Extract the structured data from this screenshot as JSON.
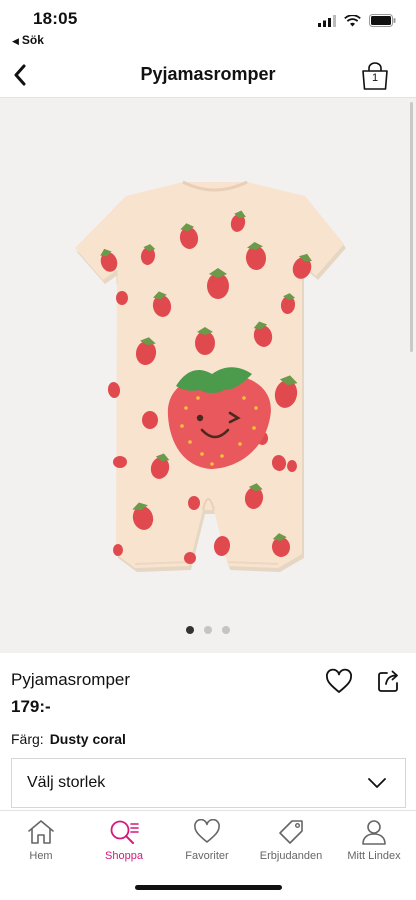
{
  "status_bar": {
    "time": "18:05",
    "back_app": "Sök"
  },
  "header": {
    "title": "Pyjamasromper",
    "cart_count": "1"
  },
  "product": {
    "name": "Pyjamasromper",
    "price": "179:-",
    "color_label": "Färg:",
    "color_value": "Dusty coral",
    "size_select": "Välj storlek",
    "image_count": 3,
    "active_image_index": 0
  },
  "bottom_nav": {
    "items": [
      {
        "label": "Hem",
        "icon": "home-icon"
      },
      {
        "label": "Shoppa",
        "icon": "search-list-icon"
      },
      {
        "label": "Favoriter",
        "icon": "heart-icon"
      },
      {
        "label": "Erbjudanden",
        "icon": "tag-icon"
      },
      {
        "label": "Mitt Lindex",
        "icon": "user-icon"
      }
    ],
    "active_index": 1
  },
  "colors": {
    "accent": "#d4197a",
    "image_background": "#f2f1ef",
    "garment": "#f8e3cf",
    "strawberry": "#e04a4f"
  }
}
